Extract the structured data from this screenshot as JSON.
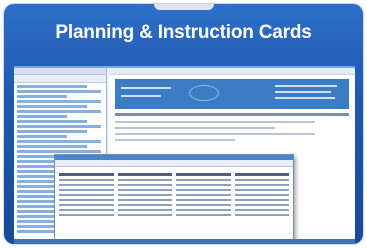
{
  "card": {
    "title": "Planning & Instruction Cards"
  },
  "colors": {
    "card_top": "#2d6fc9",
    "card_bottom": "#184a96",
    "accent": "#5e95d8"
  },
  "icons": {
    "doc_logo": "brand-logo-icon"
  }
}
